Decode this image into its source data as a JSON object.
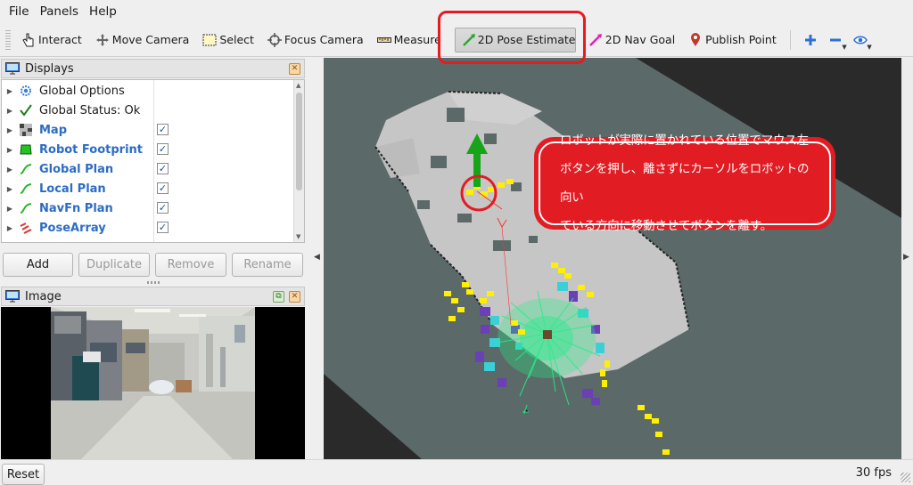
{
  "menu": {
    "file": "File",
    "panels": "Panels",
    "help": "Help"
  },
  "toolbar": {
    "interact": "Interact",
    "move_camera": "Move Camera",
    "select": "Select",
    "focus_camera": "Focus Camera",
    "measure": "Measure",
    "pose_estimate": "2D Pose Estimate",
    "nav_goal": "2D Nav Goal",
    "publish_point": "Publish Point",
    "active_tool": "2D Pose Estimate"
  },
  "displays": {
    "title": "Displays",
    "items": [
      {
        "label": "Global Options",
        "icon": "gear-icon",
        "checked": null
      },
      {
        "label": "Global Status: Ok",
        "icon": "checkmark-icon",
        "checked": null
      },
      {
        "label": "Map",
        "icon": "map-icon",
        "checked": true
      },
      {
        "label": "Robot Footprint",
        "icon": "polygon-icon",
        "checked": true
      },
      {
        "label": "Global Plan",
        "icon": "path-icon",
        "checked": true
      },
      {
        "label": "Local Plan",
        "icon": "path-icon",
        "checked": true
      },
      {
        "label": "NavFn Plan",
        "icon": "path-icon",
        "checked": true
      },
      {
        "label": "PoseArray",
        "icon": "pose-array-icon",
        "checked": true
      }
    ],
    "buttons": {
      "add": "Add",
      "duplicate": "Duplicate",
      "remove": "Remove",
      "rename": "Rename"
    }
  },
  "image_panel": {
    "title": "Image"
  },
  "callout": {
    "lines": [
      "ロボットが実際に置かれている位置でマウス左",
      "ボタンを押し、離さずにカーソルをロボットの向い",
      "ている方向に移動させてボタンを離す。"
    ]
  },
  "status": {
    "reset": "Reset",
    "fps": "30 fps"
  },
  "colors": {
    "callout_red": "#e21c23",
    "link_blue": "#2b6cc4",
    "floor": "#5b6968",
    "costmap_yellow": "#ffef00",
    "particles": "#22ee88"
  }
}
